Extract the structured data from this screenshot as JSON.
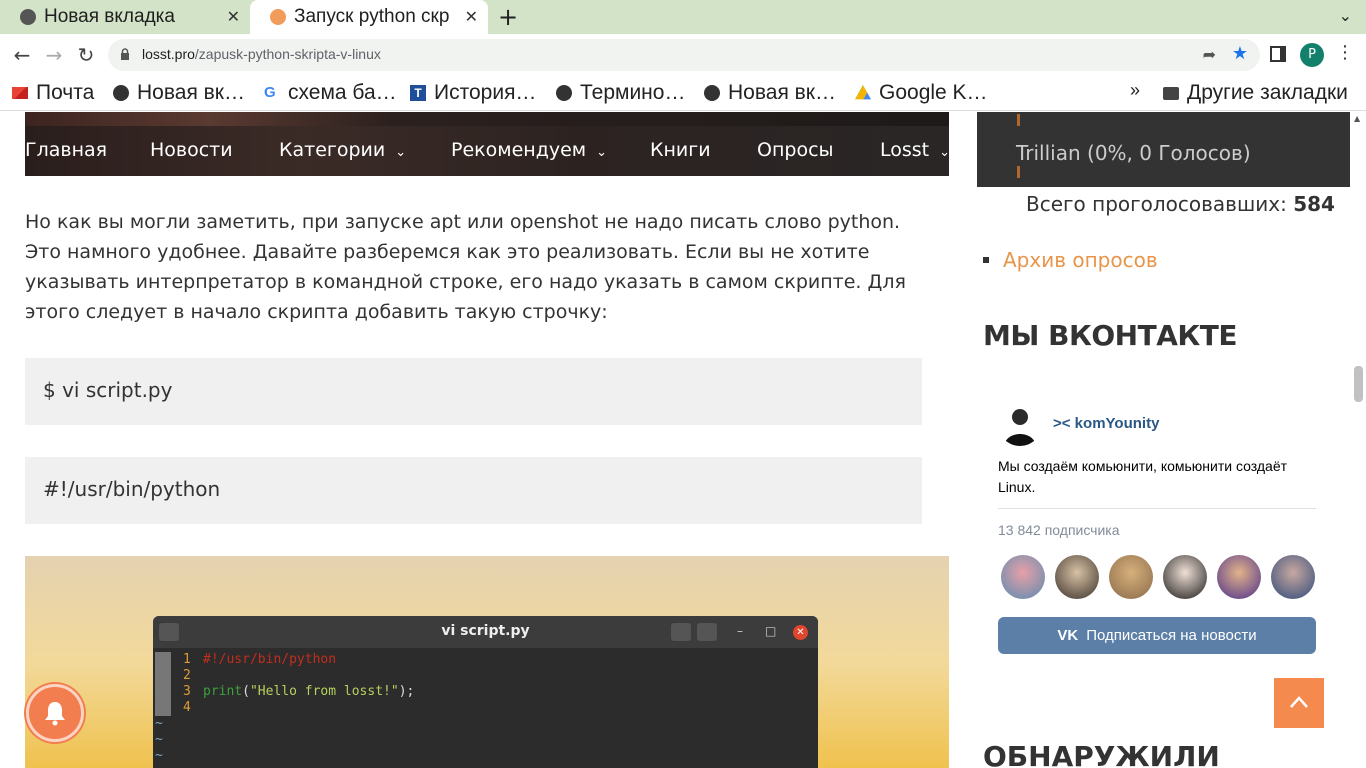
{
  "browser": {
    "tabs": [
      {
        "title": "Новая вкладка",
        "close": "✕"
      },
      {
        "title": "Запуск python скр",
        "close": "✕"
      }
    ],
    "new_tab": "+",
    "url_host": "losst.pro",
    "url_path": "/zapusk-python-skripta-v-linux",
    "profile_initial": "P",
    "bookmarks": [
      {
        "label": "Почта",
        "icon": "gmail-icon"
      },
      {
        "label": "Новая вк…",
        "icon": "globe-icon"
      },
      {
        "label": "схема ба…",
        "icon": "google-icon"
      },
      {
        "label": "История…",
        "icon": "t-icon"
      },
      {
        "label": "Термино…",
        "icon": "globe-icon"
      },
      {
        "label": "Новая вк…",
        "icon": "globe-icon"
      },
      {
        "label": "Google K…",
        "icon": "google-drive-icon"
      }
    ],
    "bookmarks_more": "»",
    "other_bookmarks": "Другие закладки"
  },
  "site_nav": [
    {
      "label": "Главная",
      "dropdown": false
    },
    {
      "label": "Новости",
      "dropdown": false
    },
    {
      "label": "Категории",
      "dropdown": true
    },
    {
      "label": "Рекомендуем",
      "dropdown": true
    },
    {
      "label": "Книги",
      "dropdown": false
    },
    {
      "label": "Опросы",
      "dropdown": false
    },
    {
      "label": "Losst",
      "dropdown": true
    }
  ],
  "article": {
    "paragraph": "Но как вы могли заметить, при запуске apt или openshot не надо писать слово python. Это намного удобнее. Давайте разберемся как это реализовать. Если вы не хотите указывать интерпретатор в командной строке, его надо указать в самом скрипте. Для этого следует в начало скрипта добавить такую строчку:",
    "code1": "$ vi script.py",
    "code2": "#!/usr/bin/python"
  },
  "terminal": {
    "title": "vi script.py",
    "lines": [
      {
        "num": "1",
        "code": "#!/usr/bin/python"
      },
      {
        "num": "2",
        "code": ""
      },
      {
        "num": "3",
        "code_fn": "print",
        "code_open": "(",
        "code_str": "\"Hello from losst!\"",
        "code_close": ");"
      },
      {
        "num": "4",
        "code": ""
      }
    ],
    "tilde": "~"
  },
  "sidebar": {
    "poll_option": "Trillian (0%, 0 Голосов)",
    "poll_total_label": "Всего проголосовавших:",
    "poll_total_value": "584",
    "archive_link": "Архив опросов",
    "vk_heading": "МЫ ВКОНТАКТЕ",
    "vk_group_name": ">< komYounity",
    "vk_description": "Мы создаём комьюнити, комьюнити создаёт Linux.",
    "vk_subscribers": "13 842 подписчика",
    "vk_subscribe_button": "Подписаться на новости",
    "vk_logo": "VK",
    "next_heading": "ОБНАРУЖИЛИ"
  },
  "colors": {
    "accent_orange": "#f58a4f",
    "vk_blue": "#5b7fa6",
    "link_orange": "#e8954a"
  }
}
